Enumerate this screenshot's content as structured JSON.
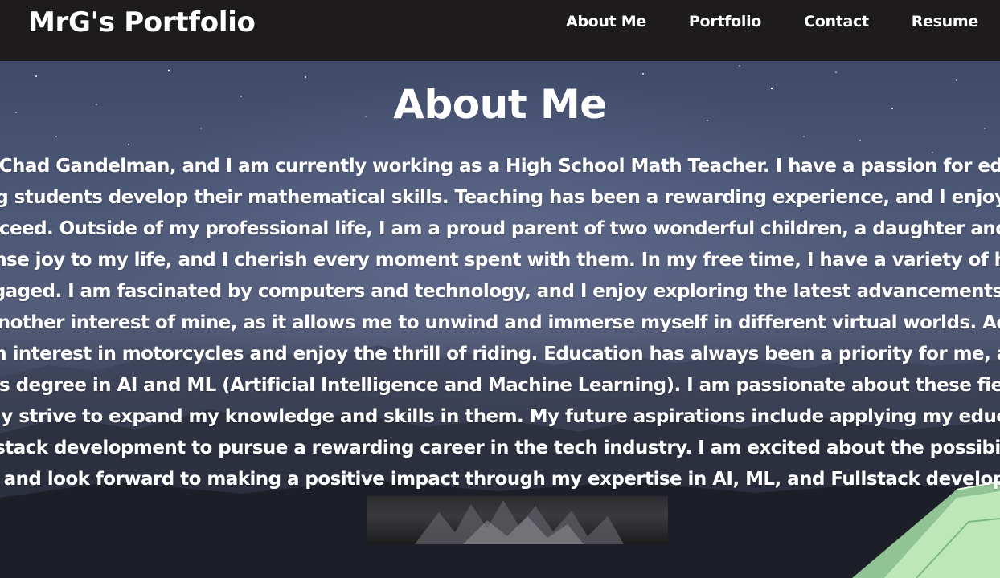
{
  "navbar": {
    "brand": "MrG's Portfolio",
    "links": [
      {
        "label": "About Me"
      },
      {
        "label": "Portfolio"
      },
      {
        "label": "Contact"
      },
      {
        "label": "Resume"
      }
    ]
  },
  "about": {
    "title": "About Me",
    "bio": "My name is Chad Gandelman, and I am currently working as a High School Math Teacher. I have a passion for education and love helping students develop their mathematical skills. Teaching has been a rewarding experience, and I enjoy seeing my students succeed. Outside of my professional life, I am a proud parent of two wonderful children, a daughter and a son. They bring immense joy to my life, and I cherish every moment spent with them. In my free time, I have a variety of hobbies that keep me engaged. I am fascinated by computers and technology, and I enjoy exploring the latest advancements in the field. Gaming is another interest of mine, as it allows me to unwind and immerse myself in different virtual worlds. Additionally, I have a keen interest in motorcycles and enjoy the thrill of riding. Education has always been a priority for me, and I hold a Master's degree in AI and ML (Artificial Intelligence and Machine Learning). I am passionate about these fields and continuously strive to expand my knowledge and skills in them. My future aspirations include applying my education in AI, ML, and Fullstack development to pursue a rewarding career in the tech industry. I am excited about the possibilities that lie ahead and look forward to making a positive impact through my expertise in AI, ML, and Fullstack development."
  },
  "colors": {
    "navbar_bg": "#1d1b1b",
    "text": "#ffffff"
  }
}
